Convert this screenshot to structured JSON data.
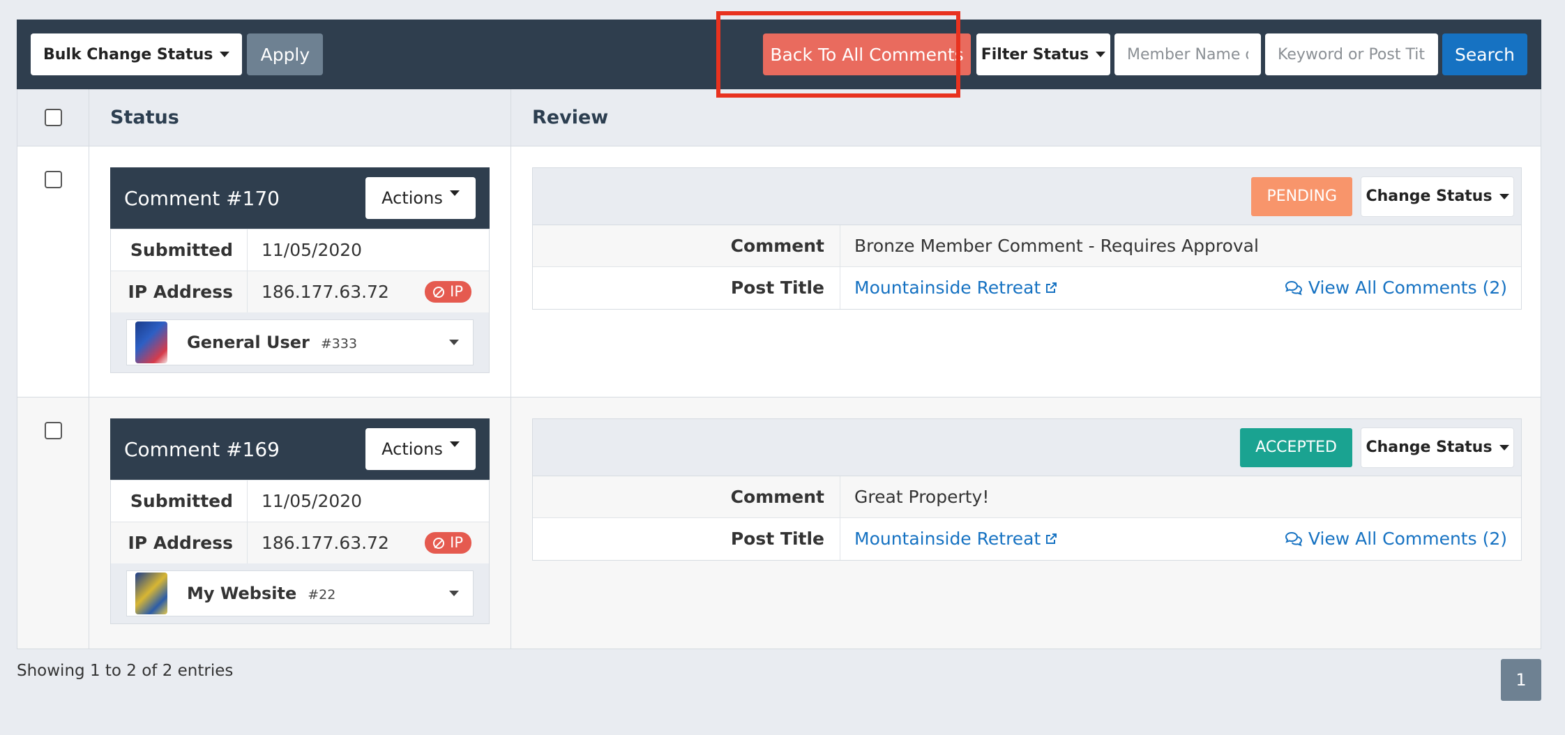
{
  "toolbar": {
    "bulk_label": "Bulk Change Status",
    "apply_label": "Apply",
    "back_label": "Back To All Comments",
    "filter_label": "Filter Status",
    "member_placeholder": "Member Name or ID",
    "keyword_placeholder": "Keyword or Post Title",
    "search_label": "Search"
  },
  "table": {
    "headers": {
      "status": "Status",
      "review": "Review"
    },
    "rows": [
      {
        "comment_title": "Comment #170",
        "actions_label": "Actions",
        "submitted_label": "Submitted",
        "submitted": "11/05/2020",
        "ip_label": "IP Address",
        "ip": "186.177.63.72",
        "ip_badge": "IP",
        "user_name": "General User",
        "user_id": "#333",
        "status_badge": "PENDING",
        "change_status_label": "Change Status",
        "comment_label": "Comment",
        "comment": "Bronze Member Comment - Requires Approval",
        "post_title_label": "Post Title",
        "post_title": "Mountainside Retreat",
        "view_all": "View All Comments (2)"
      },
      {
        "comment_title": "Comment #169",
        "actions_label": "Actions",
        "submitted_label": "Submitted",
        "submitted": "11/05/2020",
        "ip_label": "IP Address",
        "ip": "186.177.63.72",
        "ip_badge": "IP",
        "user_name": "My Website",
        "user_id": "#22",
        "status_badge": "ACCEPTED",
        "change_status_label": "Change Status",
        "comment_label": "Comment",
        "comment": "Great Property!",
        "post_title_label": "Post Title",
        "post_title": "Mountainside Retreat",
        "view_all": "View All Comments (2)"
      }
    ]
  },
  "footer": {
    "entries_text": "Showing 1 to 2 of 2 entries",
    "page": "1"
  },
  "colors": {
    "toolbar_bg": "#2f3e4e",
    "back_button": "#e96b5e",
    "search_button": "#1672c2",
    "pending": "#f8956b",
    "accepted": "#1aa391",
    "highlight": "#e8321f"
  }
}
